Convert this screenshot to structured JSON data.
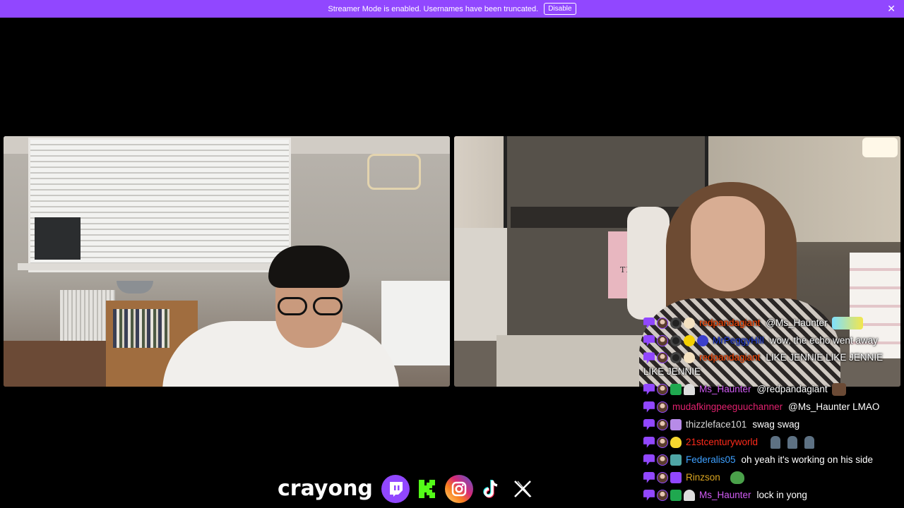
{
  "banner": {
    "message": "Streamer Mode is enabled. Usernames have been truncated.",
    "disable_label": "Disable",
    "close_glyph": "✕"
  },
  "overlay": {
    "left_sign_text": "THE",
    "channel_name": "crayong",
    "socials": [
      "twitch-icon",
      "kick-icon",
      "instagram-icon",
      "tiktok-icon",
      "x-icon"
    ]
  },
  "chat": {
    "messages": [
      {
        "user": "redpandagiant",
        "color": "#ff4500",
        "text": "@Ms_Haunter",
        "emote": "bird"
      },
      {
        "user": "MrPeggyHill",
        "color": "#1e3ad6",
        "text": "wow, the echo went away"
      },
      {
        "user": "redpandagiant",
        "color": "#ff4500",
        "text": "LIKE JENNIE LIKE JENNIE LIKE JENNIE"
      },
      {
        "user": "Ms_Haunter",
        "color": "#d25cf5",
        "text": "@redpandagiant",
        "emote": "dog"
      },
      {
        "user": "mudafkingpeeguuchanner",
        "color": "#e0216e",
        "text": "@Ms_Haunter LMAO"
      },
      {
        "user": "thizzleface101",
        "color": "#d9d9d9",
        "text": "swag swag"
      },
      {
        "user": "21stcenturyworld",
        "color": "#ff2a1a",
        "text": "",
        "emote": "people"
      },
      {
        "user": "Federalis05",
        "color": "#3ea0ff",
        "text": "oh yeah it's working on his side"
      },
      {
        "user": "Rinzson",
        "color": "#daa520",
        "text": "",
        "emote": "pepe"
      },
      {
        "user": "Ms_Haunter",
        "color": "#d25cf5",
        "text": "lock in yong"
      }
    ]
  },
  "colors": {
    "banner": "#9147ff",
    "background": "#000000"
  }
}
